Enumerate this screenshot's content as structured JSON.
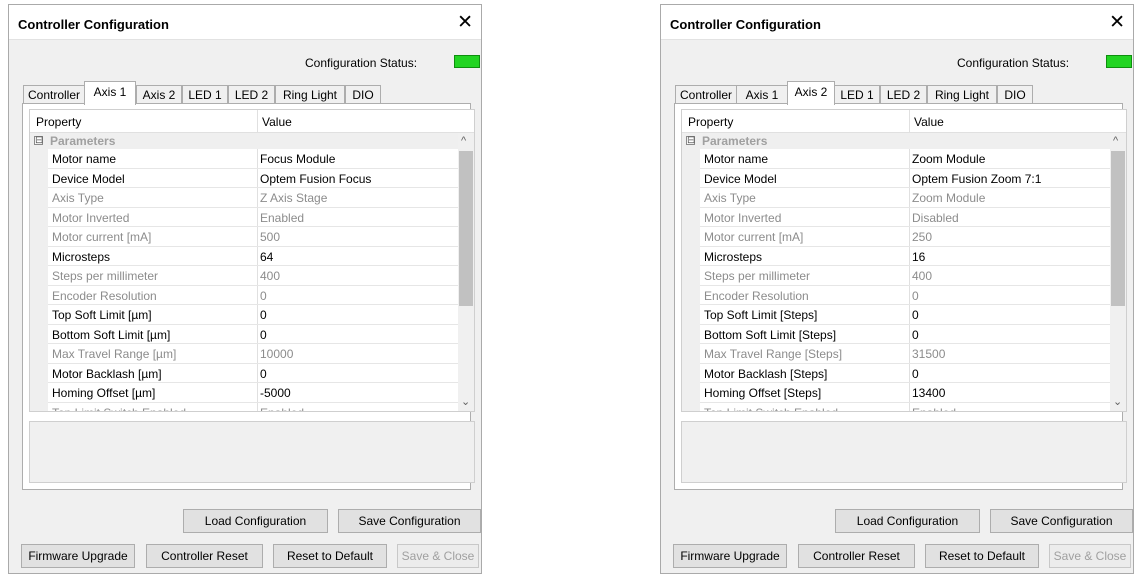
{
  "dialogs": [
    {
      "title": "Controller Configuration",
      "close_glyph": "✕",
      "status_label": "Configuration Status:",
      "status_color": "#22d422",
      "tabs": [
        "Controller",
        "Axis 1",
        "Axis 2",
        "LED 1",
        "LED 2",
        "Ring Light",
        "DIO"
      ],
      "active_tab": "Axis 1",
      "columns": {
        "property": "Property",
        "value": "Value"
      },
      "category": {
        "expander": "⊟",
        "label": "Parameters"
      },
      "rows": [
        {
          "name": "Motor name",
          "value": "Focus Module",
          "readonly": false
        },
        {
          "name": "Device Model",
          "value": "Optem Fusion Focus",
          "readonly": false
        },
        {
          "name": "Axis Type",
          "value": "Z Axis Stage",
          "readonly": true
        },
        {
          "name": "Motor Inverted",
          "value": "Enabled",
          "readonly": true
        },
        {
          "name": "Motor current [mA]",
          "value": "500",
          "readonly": true
        },
        {
          "name": "Microsteps",
          "value": "64",
          "readonly": false
        },
        {
          "name": "Steps per millimeter",
          "value": "400",
          "readonly": true
        },
        {
          "name": "Encoder Resolution",
          "value": "0",
          "readonly": true
        },
        {
          "name": "Top Soft Limit [µm]",
          "value": "0",
          "readonly": false
        },
        {
          "name": "Bottom Soft Limit [µm]",
          "value": "0",
          "readonly": false
        },
        {
          "name": "Max Travel Range [µm]",
          "value": "10000",
          "readonly": true
        },
        {
          "name": "Motor Backlash [µm]",
          "value": "0",
          "readonly": false
        },
        {
          "name": "Homing Offset [µm]",
          "value": "-5000",
          "readonly": false
        },
        {
          "name": "Top Limit Switch Enabled",
          "value": "Enabled",
          "readonly": true
        }
      ],
      "buttons": {
        "load_config": "Load Configuration",
        "save_config": "Save Configuration",
        "firmware_upgrade": "Firmware Upgrade",
        "controller_reset": "Controller Reset",
        "reset_default": "Reset to Default",
        "save_close": "Save & Close"
      }
    },
    {
      "title": "Controller Configuration",
      "close_glyph": "✕",
      "status_label": "Configuration Status:",
      "status_color": "#22d422",
      "tabs": [
        "Controller",
        "Axis 1",
        "Axis 2",
        "LED 1",
        "LED 2",
        "Ring Light",
        "DIO"
      ],
      "active_tab": "Axis 2",
      "columns": {
        "property": "Property",
        "value": "Value"
      },
      "category": {
        "expander": "⊟",
        "label": "Parameters"
      },
      "rows": [
        {
          "name": "Motor name",
          "value": "Zoom Module",
          "readonly": false
        },
        {
          "name": "Device Model",
          "value": "Optem Fusion Zoom 7:1",
          "readonly": false
        },
        {
          "name": "Axis Type",
          "value": "Zoom Module",
          "readonly": true
        },
        {
          "name": "Motor Inverted",
          "value": "Disabled",
          "readonly": true
        },
        {
          "name": "Motor current [mA]",
          "value": "250",
          "readonly": true
        },
        {
          "name": "Microsteps",
          "value": "16",
          "readonly": false
        },
        {
          "name": "Steps per millimeter",
          "value": "400",
          "readonly": true
        },
        {
          "name": "Encoder Resolution",
          "value": "0",
          "readonly": true
        },
        {
          "name": "Top Soft Limit [Steps]",
          "value": "0",
          "readonly": false
        },
        {
          "name": "Bottom Soft Limit [Steps]",
          "value": "0",
          "readonly": false
        },
        {
          "name": "Max Travel Range [Steps]",
          "value": "31500",
          "readonly": true
        },
        {
          "name": "Motor Backlash [Steps]",
          "value": "0",
          "readonly": false
        },
        {
          "name": "Homing Offset [Steps]",
          "value": "13400",
          "readonly": false
        },
        {
          "name": "Top Limit Switch Enabled",
          "value": "Enabled",
          "readonly": true
        }
      ],
      "buttons": {
        "load_config": "Load Configuration",
        "save_config": "Save Configuration",
        "firmware_upgrade": "Firmware Upgrade",
        "controller_reset": "Controller Reset",
        "reset_default": "Reset to Default",
        "save_close": "Save & Close"
      }
    }
  ],
  "scroll_glyphs": {
    "up": "^",
    "down": "⌄"
  }
}
